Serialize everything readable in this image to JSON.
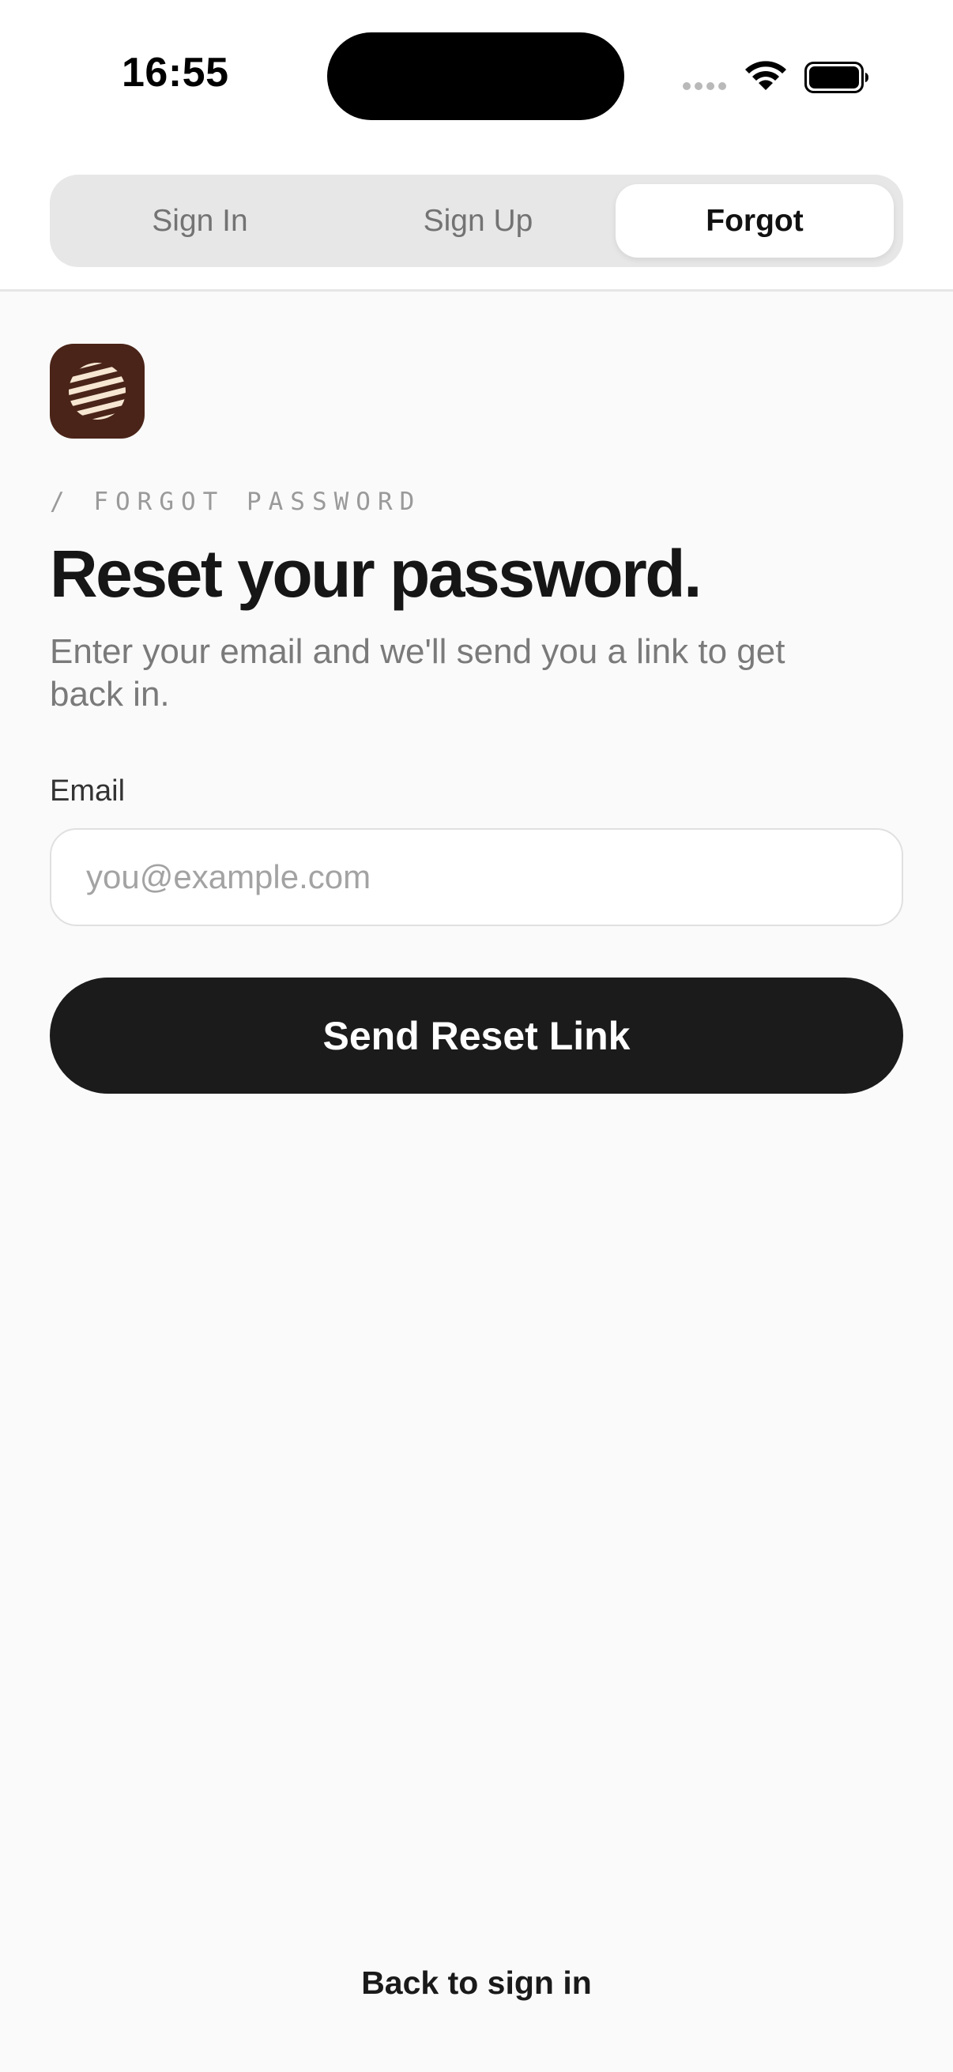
{
  "status_bar": {
    "time": "16:55",
    "wifi_icon": "wifi-icon",
    "battery_icon": "battery-icon"
  },
  "tabs": [
    {
      "label": "Sign In",
      "selected": false
    },
    {
      "label": "Sign Up",
      "selected": false
    },
    {
      "label": "Forgot",
      "selected": true
    }
  ],
  "brand": {
    "icon": "striped-ball-logo",
    "color": "#4a2418"
  },
  "form": {
    "eyebrow": "/ FORGOT PASSWORD",
    "title": "Reset your password.",
    "subtitle": "Enter your email and we'll send you a link to get back in.",
    "email_label": "Email",
    "email_placeholder": "you@example.com",
    "email_value": "",
    "submit_label": "Send Reset Link"
  },
  "footer": {
    "back_link": "Back to sign in"
  },
  "colors": {
    "background": "#fafafa",
    "primary_button": "#1b1b1b",
    "segment_track": "#e7e7e7"
  }
}
